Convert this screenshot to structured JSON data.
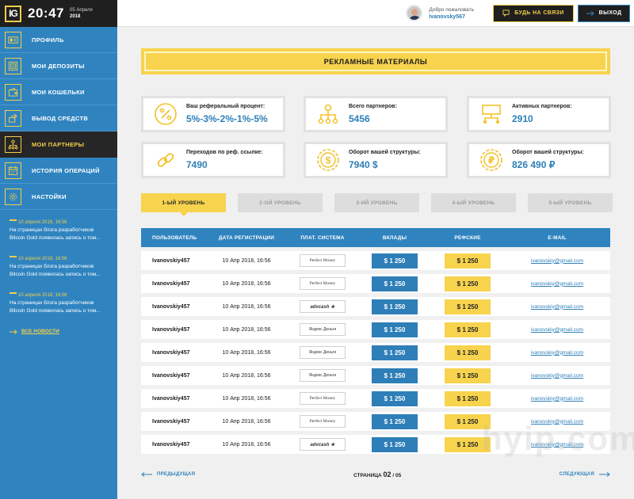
{
  "header": {
    "logo": "IG",
    "time": "20:47",
    "date_day": "05 Апреля",
    "date_year": "2018",
    "welcome": "Добро пожаловать",
    "username": "Ivanovsky567",
    "contact_button": "БУДЬ НА СВЯЗИ",
    "logout_button": "ВЫХОД"
  },
  "sidebar": {
    "items": [
      {
        "label": "ПРОФИЛЬ",
        "icon": "id-card-icon"
      },
      {
        "label": "МОИ ДЕПОЗИТЫ",
        "icon": "safe-icon"
      },
      {
        "label": "МОИ КОШЕЛЬКИ",
        "icon": "wallet-icon"
      },
      {
        "label": "ВЫВОД СРЕДСТВ",
        "icon": "withdraw-icon"
      },
      {
        "label": "МОИ ПАРТНЕРЫ",
        "icon": "partners-icon",
        "active": true
      },
      {
        "label": "ИСТОРИЯ ОПЕРАЦИЙ",
        "icon": "calendar-icon"
      },
      {
        "label": "НАСТОЙКИ",
        "icon": "gear-icon"
      }
    ],
    "news": [
      {
        "date": "10 апреля 2018, 16:56",
        "line1": "На страницах блога разработчиков",
        "line2": "Bitcoin Gold появилась запись о том..."
      },
      {
        "date": "10 апреля 2018, 16:56",
        "line1": "На страницах блога разработчиков",
        "line2": "Bitcoin Gold появилась запись о том..."
      },
      {
        "date": "10 апреля 2018, 16:56",
        "line1": "На страницах блога разработчиков",
        "line2": "Bitcoin Gold появилась запись о том..."
      }
    ],
    "all_news": "ВСЕ НОВОСТИ"
  },
  "banner": {
    "title": "РЕКЛАМНЫЕ МАТЕРИАЛЫ"
  },
  "stats": [
    {
      "label": "Ваш реферальный процент:",
      "value": "5%-3%-2%-1%-5%",
      "icon": "percent-icon"
    },
    {
      "label": "Всего партнеров:",
      "value": "5456",
      "icon": "hierarchy-icon"
    },
    {
      "label": "Активных партнеров:",
      "value": "2910",
      "icon": "active-partners-icon"
    },
    {
      "label": "Переходов по реф. ссылке:",
      "value": "7490",
      "icon": "link-icon"
    },
    {
      "label": "Оборот вашей структуры:",
      "value": "7940 $",
      "icon": "dollar-gear-icon"
    },
    {
      "label": "Оборот вашей структуры:",
      "value": "826 490 ₽",
      "icon": "ruble-gear-icon"
    }
  ],
  "tabs": [
    {
      "label": "1-ЫЙ УРОВЕНЬ",
      "active": true
    },
    {
      "label": "2-ОЙ УРОВЕНЬ"
    },
    {
      "label": "3-ИЙ УРОВЕНЬ"
    },
    {
      "label": "4-ЫЙ УРОВЕНЬ"
    },
    {
      "label": "5-ЫЙ УРОВЕНЬ"
    }
  ],
  "table": {
    "headers": [
      "ПОЛЬЗОВАТЕЛЬ",
      "ДАТА РЕГИСТРАЦИИ",
      "ПЛАТ. СИСТЕМА",
      "ВКЛАДЫ",
      "РЕФСКИЕ",
      "E-MAIL"
    ],
    "rows": [
      {
        "user": "Ivanovskiy457",
        "date": "10 Апр 2018, 16:56",
        "payment": "Perfect Money",
        "ptype": "pm",
        "deposit": "$ 1 250",
        "ref": "$ 1 250",
        "email": "ivanovskiy@gmail.com"
      },
      {
        "user": "Ivanovskiy457",
        "date": "10 Апр 2018, 16:56",
        "payment": "Perfect Money",
        "ptype": "pm",
        "deposit": "$ 1 250",
        "ref": "$ 1 250",
        "email": "ivanovskiy@gmail.com"
      },
      {
        "user": "Ivanovskiy457",
        "date": "10 Апр 2018, 16:56",
        "payment": "advcash ★",
        "ptype": "adv",
        "deposit": "$ 1 250",
        "ref": "$ 1 250",
        "email": "ivanovskiy@gmail.com"
      },
      {
        "user": "Ivanovskiy457",
        "date": "10 Апр 2018, 16:56",
        "payment": "Яндекс Деньги",
        "ptype": "yandex",
        "deposit": "$ 1 250",
        "ref": "$ 1 250",
        "email": "ivanovskiy@gmail.com"
      },
      {
        "user": "Ivanovskiy457",
        "date": "10 Апр 2018, 16:56",
        "payment": "Яндекс Деньги",
        "ptype": "yandex",
        "deposit": "$ 1 250",
        "ref": "$ 1 250",
        "email": "ivanovskiy@gmail.com"
      },
      {
        "user": "Ivanovskiy457",
        "date": "10 Апр 2018, 16:56",
        "payment": "Яндекс Деньги",
        "ptype": "yandex",
        "deposit": "$ 1 250",
        "ref": "$ 1 250",
        "email": "ivanovskiy@gmail.com"
      },
      {
        "user": "Ivanovskiy457",
        "date": "10 Апр 2018, 16:56",
        "payment": "Perfect Money",
        "ptype": "pm",
        "deposit": "$ 1 250",
        "ref": "$ 1 250",
        "email": "ivanovskiy@gmail.com"
      },
      {
        "user": "Ivanovskiy457",
        "date": "10 Апр 2018, 16:56",
        "payment": "Perfect Money",
        "ptype": "pm",
        "deposit": "$ 1 250",
        "ref": "$ 1 250",
        "email": "ivanovskiy@gmail.com"
      },
      {
        "user": "Ivanovskiy457",
        "date": "10 Апр 2018, 16:56",
        "payment": "advcash ★",
        "ptype": "adv",
        "deposit": "$ 1 250",
        "ref": "$ 1 250",
        "email": "ivanovskiy@gmail.com"
      }
    ]
  },
  "pager": {
    "prev": "ПРЕДЫДУЩАЯ",
    "page_label": "СТРАНИЦА",
    "current": "02",
    "total": "/ 05",
    "next": "СЛЕДУЮЩАЯ"
  },
  "watermark": "hyip.com",
  "colors": {
    "accent_yellow": "#f7d34e",
    "accent_blue": "#2f84c0",
    "dark": "#1f1f1f"
  }
}
